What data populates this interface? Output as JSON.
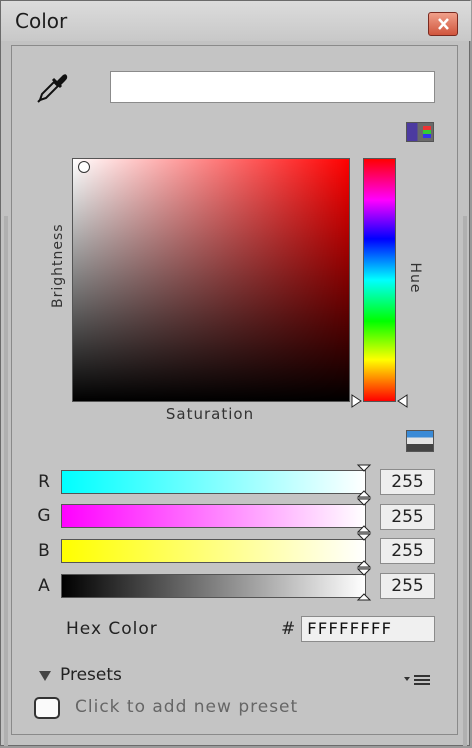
{
  "window": {
    "title": "Color"
  },
  "icons": {
    "close": "close-icon",
    "eyedropper": "eyedropper-icon",
    "gamut": "color-gamut-icon",
    "slider_mode": "slider-mode-icon",
    "presets_menu": "menu-icon",
    "presets_toggle": "triangle-down-icon"
  },
  "picker": {
    "current_color": "#FFFFFF",
    "brightness_label": "Brightness",
    "saturation_label": "Saturation",
    "hue_label": "Hue"
  },
  "sliders": [
    {
      "label": "R",
      "value": "255",
      "gradient_start": "#00ffff",
      "gradient_end": "#ffffff"
    },
    {
      "label": "G",
      "value": "255",
      "gradient_start": "#ff00ff",
      "gradient_end": "#ffffff"
    },
    {
      "label": "B",
      "value": "255",
      "gradient_start": "#ffff00",
      "gradient_end": "#ffffff"
    },
    {
      "label": "A",
      "value": "255",
      "gradient_start": "#000000",
      "gradient_end": "#ffffff"
    }
  ],
  "hex": {
    "label": "Hex Color",
    "hash": "#",
    "value": "FFFFFFFF"
  },
  "presets": {
    "label": "Presets",
    "add_text": "Click to add new preset"
  }
}
